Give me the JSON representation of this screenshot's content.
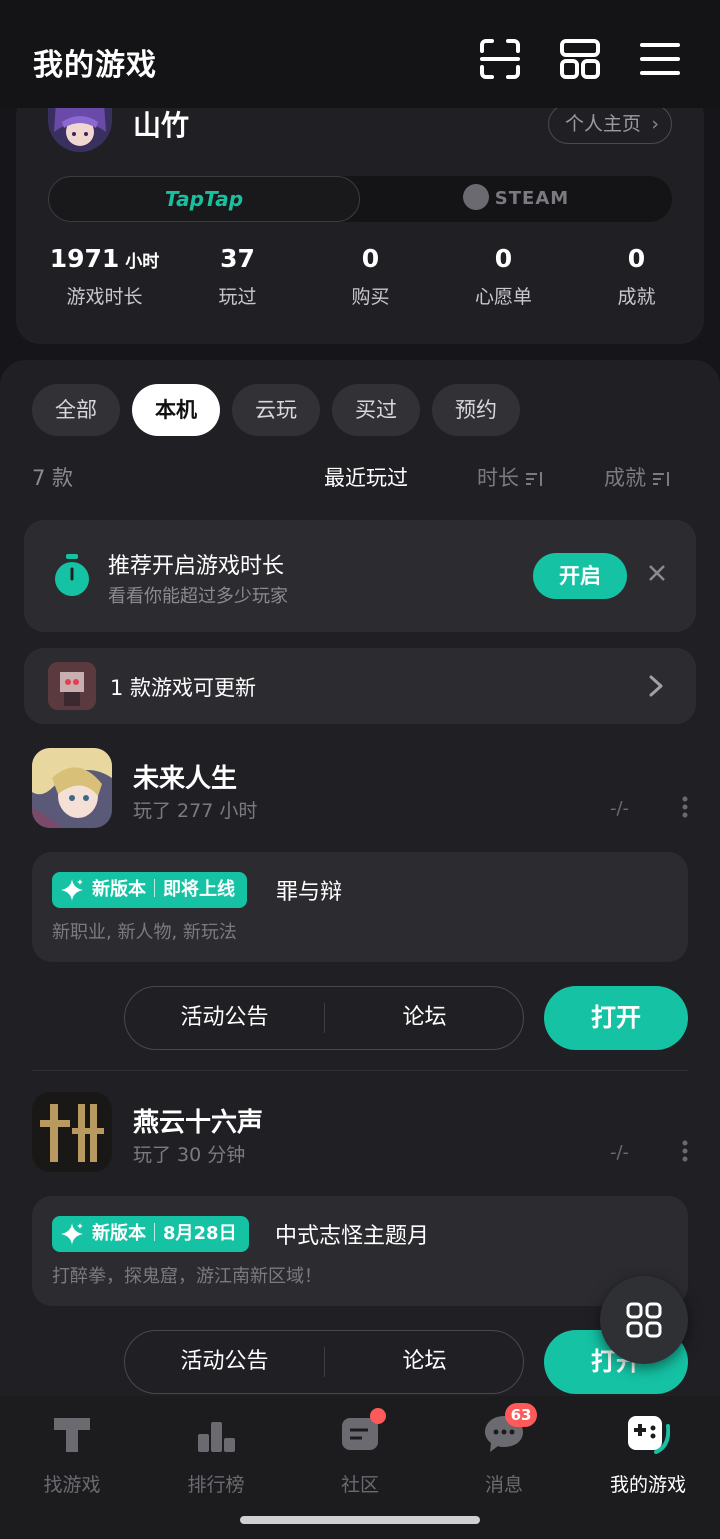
{
  "header": {
    "title": "我的游戏",
    "icons": [
      "scan-icon",
      "layout-icon",
      "menu-icon"
    ]
  },
  "profile": {
    "username": "山竹",
    "home_button": "个人主页",
    "platforms": {
      "taptap": "TapTap",
      "steam": "STEAM",
      "selected": "TapTap"
    },
    "stats": [
      {
        "value": "1971",
        "unit": "小时",
        "label": "游戏时长"
      },
      {
        "value": "37",
        "unit": "",
        "label": "玩过"
      },
      {
        "value": "0",
        "unit": "",
        "label": "购买"
      },
      {
        "value": "0",
        "unit": "",
        "label": "心愿单"
      },
      {
        "value": "0",
        "unit": "",
        "label": "成就"
      }
    ]
  },
  "filters": {
    "chips": [
      "全部",
      "本机",
      "云玩",
      "买过",
      "预约"
    ],
    "active": "本机"
  },
  "sort": {
    "count": "7 款",
    "options": [
      "最近玩过",
      "时长",
      "成就"
    ],
    "active": "最近玩过"
  },
  "recommend": {
    "title": "推荐开启游戏时长",
    "subtitle": "看看你能超过多少玩家",
    "button": "开启"
  },
  "update_banner": {
    "text": "1 款游戏可更新"
  },
  "games": [
    {
      "name": "未来人生",
      "playtime": "玩了 277 小时",
      "rating": "-/-",
      "news": {
        "badge_left": "新版本",
        "badge_right": "即将上线",
        "title": "罪与辩",
        "desc": "新职业, 新人物, 新玩法"
      },
      "actions": [
        "活动公告",
        "论坛"
      ],
      "launch": "打开"
    },
    {
      "name": "燕云十六声",
      "playtime": "玩了 30 分钟",
      "rating": "-/-",
      "news": {
        "badge_left": "新版本",
        "badge_right": "8月28日",
        "title": "中式志怪主题月",
        "desc": "打醉拳，探鬼窟，游江南新区域！"
      },
      "actions": [
        "活动公告",
        "论坛"
      ],
      "launch": "打开"
    }
  ],
  "bottom_nav": {
    "tabs": [
      "找游戏",
      "排行榜",
      "社区",
      "消息",
      "我的游戏"
    ],
    "active": "我的游戏",
    "message_badge": "63"
  },
  "colors": {
    "accent": "#15c2a4",
    "background": "#16161a",
    "card": "#2c2c30",
    "notify": "#ff5a5a"
  }
}
